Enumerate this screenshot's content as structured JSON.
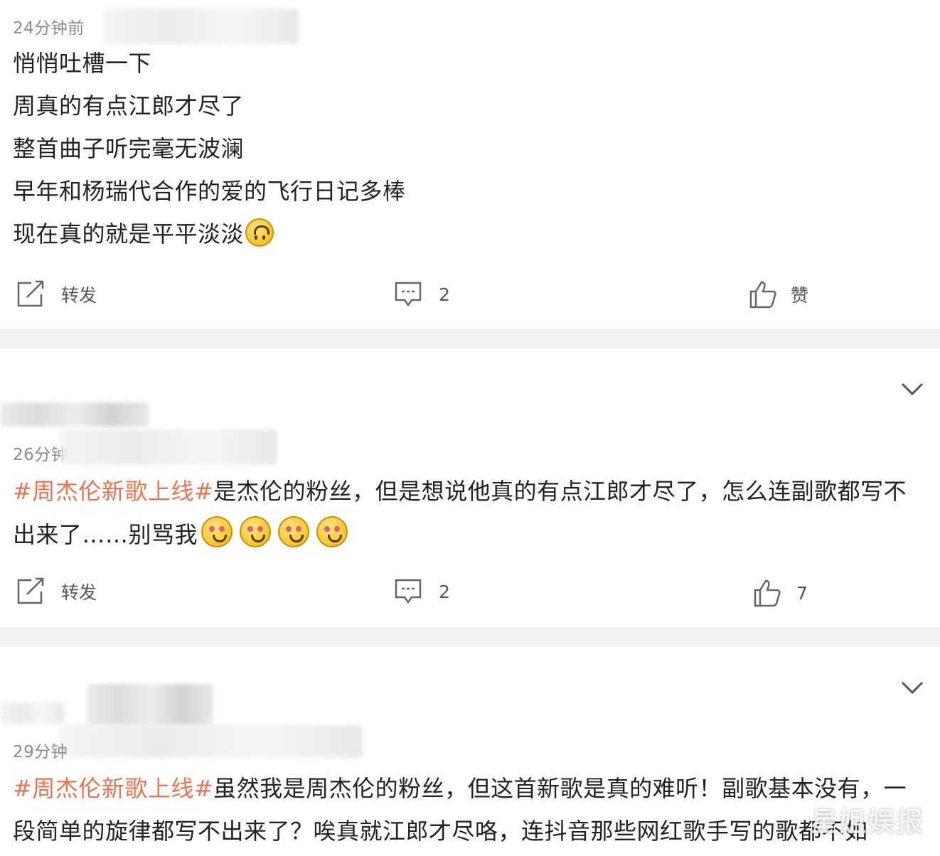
{
  "posts": [
    {
      "time": "24分钟前",
      "lines": [
        "悄悄吐槽一下",
        "周真的有点江郎才尽了",
        "整首曲子听完毫无波澜",
        "早年和杨瑞代合作的爱的飞行日记多棒",
        "现在真的就是平平淡淡"
      ],
      "repost_label": "转发",
      "comment_count": "2",
      "like_label": "赞"
    },
    {
      "time": "26分钟",
      "topic": "#周杰伦新歌上线#",
      "text_line1": "是杰伦的粉丝，但是想说他真的有点江郎才尽了，怎么连副歌都写不",
      "text_line2": "出来了……别骂我",
      "repost_label": "转发",
      "comment_count": "2",
      "like_count": "7"
    },
    {
      "time": "29分钟",
      "topic": "#周杰伦新歌上线#",
      "text_line1": "虽然我是周杰伦的粉丝，但这首新歌是真的难听！副歌基本没有，一",
      "text_line2": "段简单的旋律都写不出来了？唉真就江郎才尽咯，连抖音那些网红歌手写的歌都不如"
    }
  ],
  "watermark": "星姐娱报",
  "colors": {
    "topic": "#eb7350",
    "separator": "#f2f2f2",
    "time": "#8a8a8a"
  }
}
